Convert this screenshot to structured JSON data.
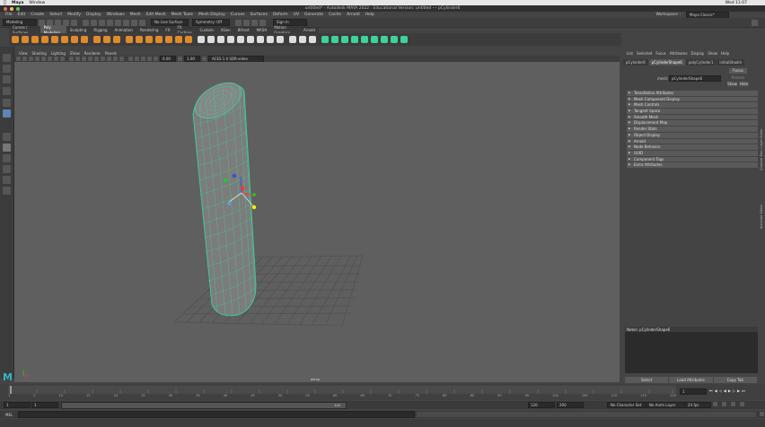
{
  "macbar": {
    "app": "Maya",
    "menu": "Window",
    "clock": "Wed 11:07"
  },
  "titlebar": {
    "title": "untitled* - Autodesk MAYA 2022 : Educational Version: untitled   ---   pCylinder6"
  },
  "menubar": {
    "items": [
      "File",
      "Edit",
      "Create",
      "Select",
      "Modify",
      "Display",
      "Windows",
      "Mesh",
      "Edit Mesh",
      "Mesh Tools",
      "Mesh Display",
      "Curves",
      "Surfaces",
      "Deform",
      "UV",
      "Generate",
      "Cache",
      "Arnold",
      "Help"
    ],
    "workspace_label": "Workspace :",
    "workspace_value": "Maya Classic*"
  },
  "statusline": {
    "mode": "Modeling",
    "live_surface": "No Live Surface",
    "symmetry": "Symmetry: Off",
    "sign_in": "Sign In"
  },
  "shelftabs": {
    "items": [
      "Curves / Surfaces",
      "Poly Modeling",
      "Sculpting",
      "Rigging",
      "Animation",
      "Rendering",
      "FX",
      "FX Caching",
      "Custom",
      "XGen",
      "Bifrost",
      "MASH",
      "Motion Graphics",
      "Arnold"
    ],
    "active": "Poly Modeling"
  },
  "panelmenu": {
    "items": [
      "View",
      "Shading",
      "Lighting",
      "Show",
      "Renderer",
      "Panels"
    ]
  },
  "paneltools": {
    "val1": "0.00",
    "val2": "1.00",
    "colorspace": "ACES 1.0 SDR-video (sRGB)"
  },
  "viewport": {
    "camera": "persp"
  },
  "channelbox": {
    "menu": [
      "List",
      "Selected",
      "Focus",
      "Attributes",
      "Display",
      "Show",
      "Help"
    ],
    "tabs": [
      "pCylinder6",
      "pCylinderShape6",
      "polyCylinder1",
      "initialShadin"
    ],
    "active_tab": "pCylinderShape6",
    "mesh_label": "mesh:",
    "mesh_value": "pCylinderShape6",
    "btn_focus": "Focus",
    "btn_presets": "Presets",
    "btn_show": "Show",
    "btn_hide": "Hide",
    "sections": [
      "Tessellation Attributes",
      "Mesh Component Display",
      "Mesh Controls",
      "Tangent Space",
      "Smooth Mesh",
      "Displacement Map",
      "Render Stats",
      "Object Display",
      "Arnold",
      "Node Behavior",
      "UUID",
      "Component Tags",
      "Extra Attributes"
    ],
    "notes_label": "Notes:  pCylinderShape6",
    "btn_select": "Select",
    "btn_load": "Load Attributes",
    "btn_copy": "Copy Tab",
    "side_tab1": "Channel Box / Layer Editor",
    "side_tab2": "Attribute Editor"
  },
  "timeslider": {
    "current": "1",
    "ticks": [
      "1",
      "5",
      "10",
      "15",
      "20",
      "25",
      "30",
      "35",
      "40",
      "45",
      "50",
      "55",
      "60",
      "65",
      "70",
      "75",
      "80",
      "85",
      "90",
      "95",
      "100",
      "105",
      "110",
      "115",
      "120"
    ]
  },
  "range": {
    "start": "1",
    "start2": "1",
    "handle": "120",
    "end": "120",
    "end2": "200",
    "character": "No Character Set",
    "anim_layer": "No Anim Layer",
    "fps": "24 fps"
  },
  "cmdline": {
    "label": "MEL"
  },
  "colors": {
    "accent": "#e08b2b",
    "wire": "#3dd39a",
    "mesh_fill": "#7c7c7c",
    "active_tab": "#5b5b5b"
  }
}
